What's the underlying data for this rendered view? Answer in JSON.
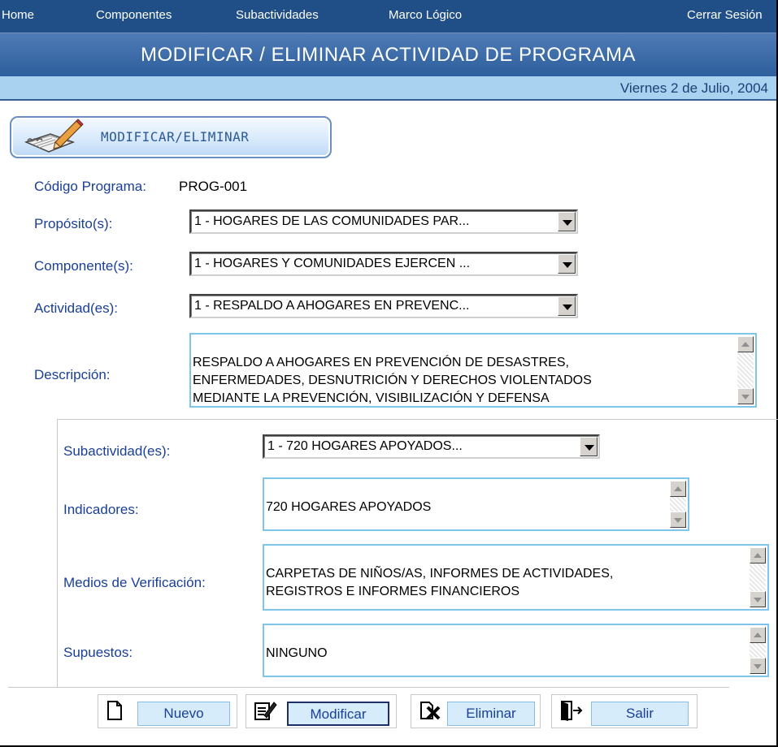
{
  "nav": {
    "home": "Home",
    "componentes": "Componentes",
    "subactividades": "Subactividades",
    "marco_logico": "Marco Lógico",
    "cerrar_sesion": "Cerrar Sesión"
  },
  "header": {
    "title": "MODIFICAR / ELIMINAR ACTIVIDAD DE PROGRAMA",
    "date": "Viernes 2 de Julio, 2004"
  },
  "tab": {
    "label": "MODIFICAR/ELIMINAR",
    "icon": "notepad-pencil-icon"
  },
  "form": {
    "codigo_label": "Código Programa:",
    "codigo_value": "PROG-001",
    "proposito_label": "Propósito(s):",
    "proposito_value": "1 - HOGARES DE LAS COMUNIDADES PAR...",
    "componente_label": "Componente(s):",
    "componente_value": "1 - HOGARES Y COMUNIDADES EJERCEN ...",
    "actividad_label": "Actividad(es):",
    "actividad_value": "1 - RESPALDO A AHOGARES EN PREVENC...",
    "descripcion_label": "Descripción:",
    "descripcion_value": "RESPALDO A AHOGARES EN PREVENCIÓN DE DESASTRES,\nENFERMEDADES, DESNUTRICIÓN Y DERECHOS VIOLENTADOS\n MEDIANTE LA PREVENCIÓN, VISIBILIZACIÓN Y DEFENSA"
  },
  "sub": {
    "subactividad_label": "Subactividad(es):",
    "subactividad_value": "1 - 720 HOGARES APOYADOS...",
    "indicadores_label": "Indicadores:",
    "indicadores_value": "720 HOGARES APOYADOS",
    "medios_label": "Medios de Verificación:",
    "medios_value": "CARPETAS DE NIÑOS/AS, INFORMES DE ACTIVIDADES,\nREGISTROS E INFORMES FINANCIEROS",
    "supuestos_label": "Supuestos:",
    "supuestos_value": "NINGUNO"
  },
  "buttons": {
    "nuevo": "Nuevo",
    "modificar": "Modificar",
    "eliminar": "Eliminar",
    "salir": "Salir"
  },
  "colors": {
    "nav_bg": "#1f4f86",
    "title_bg": "#3a6aa8",
    "date_bg": "#a8d2f0",
    "label_text": "#1a3f96",
    "field_border": "#7fc4ea"
  }
}
